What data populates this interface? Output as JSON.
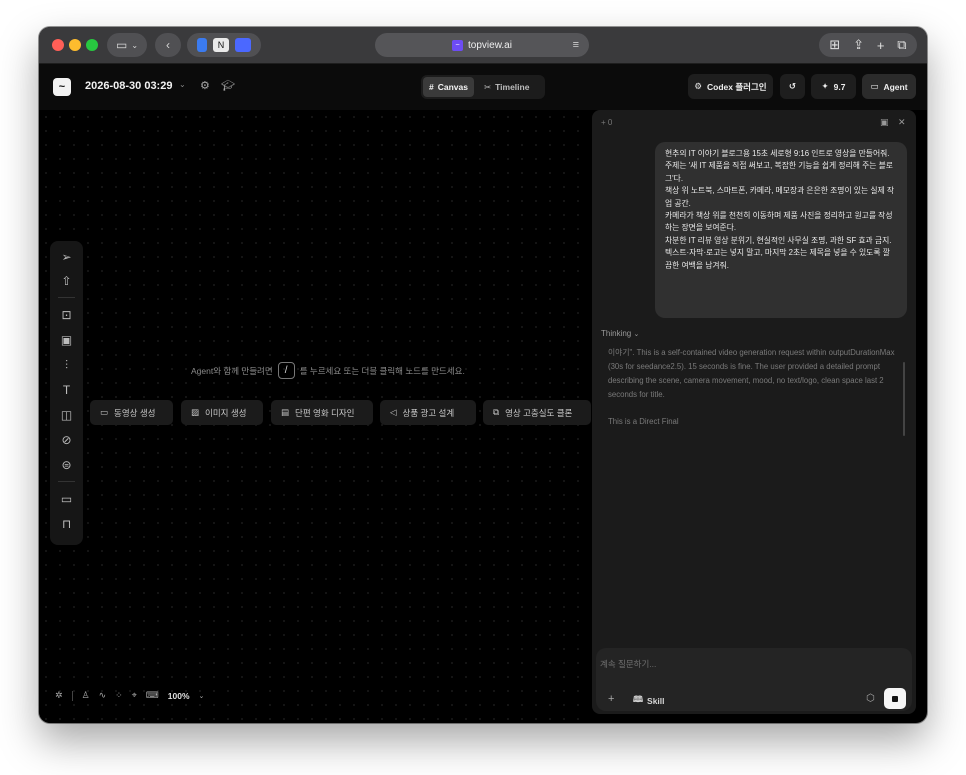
{
  "browser": {
    "url": "topview.ai",
    "right_icons": [
      "grid-icon",
      "share-icon",
      "plus-icon",
      "tabs-icon"
    ]
  },
  "header": {
    "title": "2026-08-30 03:29",
    "views": [
      {
        "label": "Canvas",
        "icon": "#",
        "active": true
      },
      {
        "label": "Timeline",
        "icon": "✂",
        "active": false
      }
    ],
    "codex_label": "Codex 플러그인",
    "credits": "9.7",
    "agent_label": "Agent"
  },
  "canvas": {
    "hint_prefix": "Agent와 함께 만들려면",
    "hint_key": "/",
    "hint_suffix": "를 누르세요 또는 더블 클릭해 노드를 만드세요.",
    "quick_actions": [
      {
        "label": "동영상 생성",
        "icon": "video-icon"
      },
      {
        "label": "이미지 생성",
        "icon": "image-icon"
      },
      {
        "label": "단편 영화 디자인",
        "icon": "film-icon"
      },
      {
        "label": "상품 광고 설계",
        "icon": "megaphone-icon"
      },
      {
        "label": "영상 고충실도 클론",
        "icon": "copy-icon"
      }
    ],
    "zoom": "100%"
  },
  "agent": {
    "counter": "+ 0",
    "user_message": [
      "현추의 IT 이야기 블로그용 15초 세로형 9:16 인트로 영상을 만들어줘.",
      "주제는 '새 IT 제품을 직접 써보고, 복잡한 기능을 쉽게 정리해 주는 블로그'다.",
      "책상 위 노트북, 스마트폰, 카메라, 메모장과 은은한 조명이 있는 실제 작업 공간.",
      "카메라가 책상 위를 천천히 이동하며 제품 사진을 정리하고 원고를 작성하는 장면을 보여준다.",
      "차분한 IT 리뷰 영상 분위기, 현실적인 사무실 조명, 과한 SF 효과 금지.",
      "텍스트·자막·로고는 넣지 말고, 마지막 2초는 제목을 넣을 수 있도록 깔끔한 여백을 남겨줘."
    ],
    "thinking_label": "Thinking",
    "thinking_text": "이야기\". This is a self-contained video generation request within outputDurationMax (30s for seedance2.5). 15 seconds is fine. The user provided a detailed prompt describing the scene, camera movement, mood, no text/logo, clean space last 2 seconds for title.",
    "thinking_final": "This is a Direct Final",
    "composer_placeholder": "계속 질문하기...",
    "skill_label": "Skill"
  }
}
